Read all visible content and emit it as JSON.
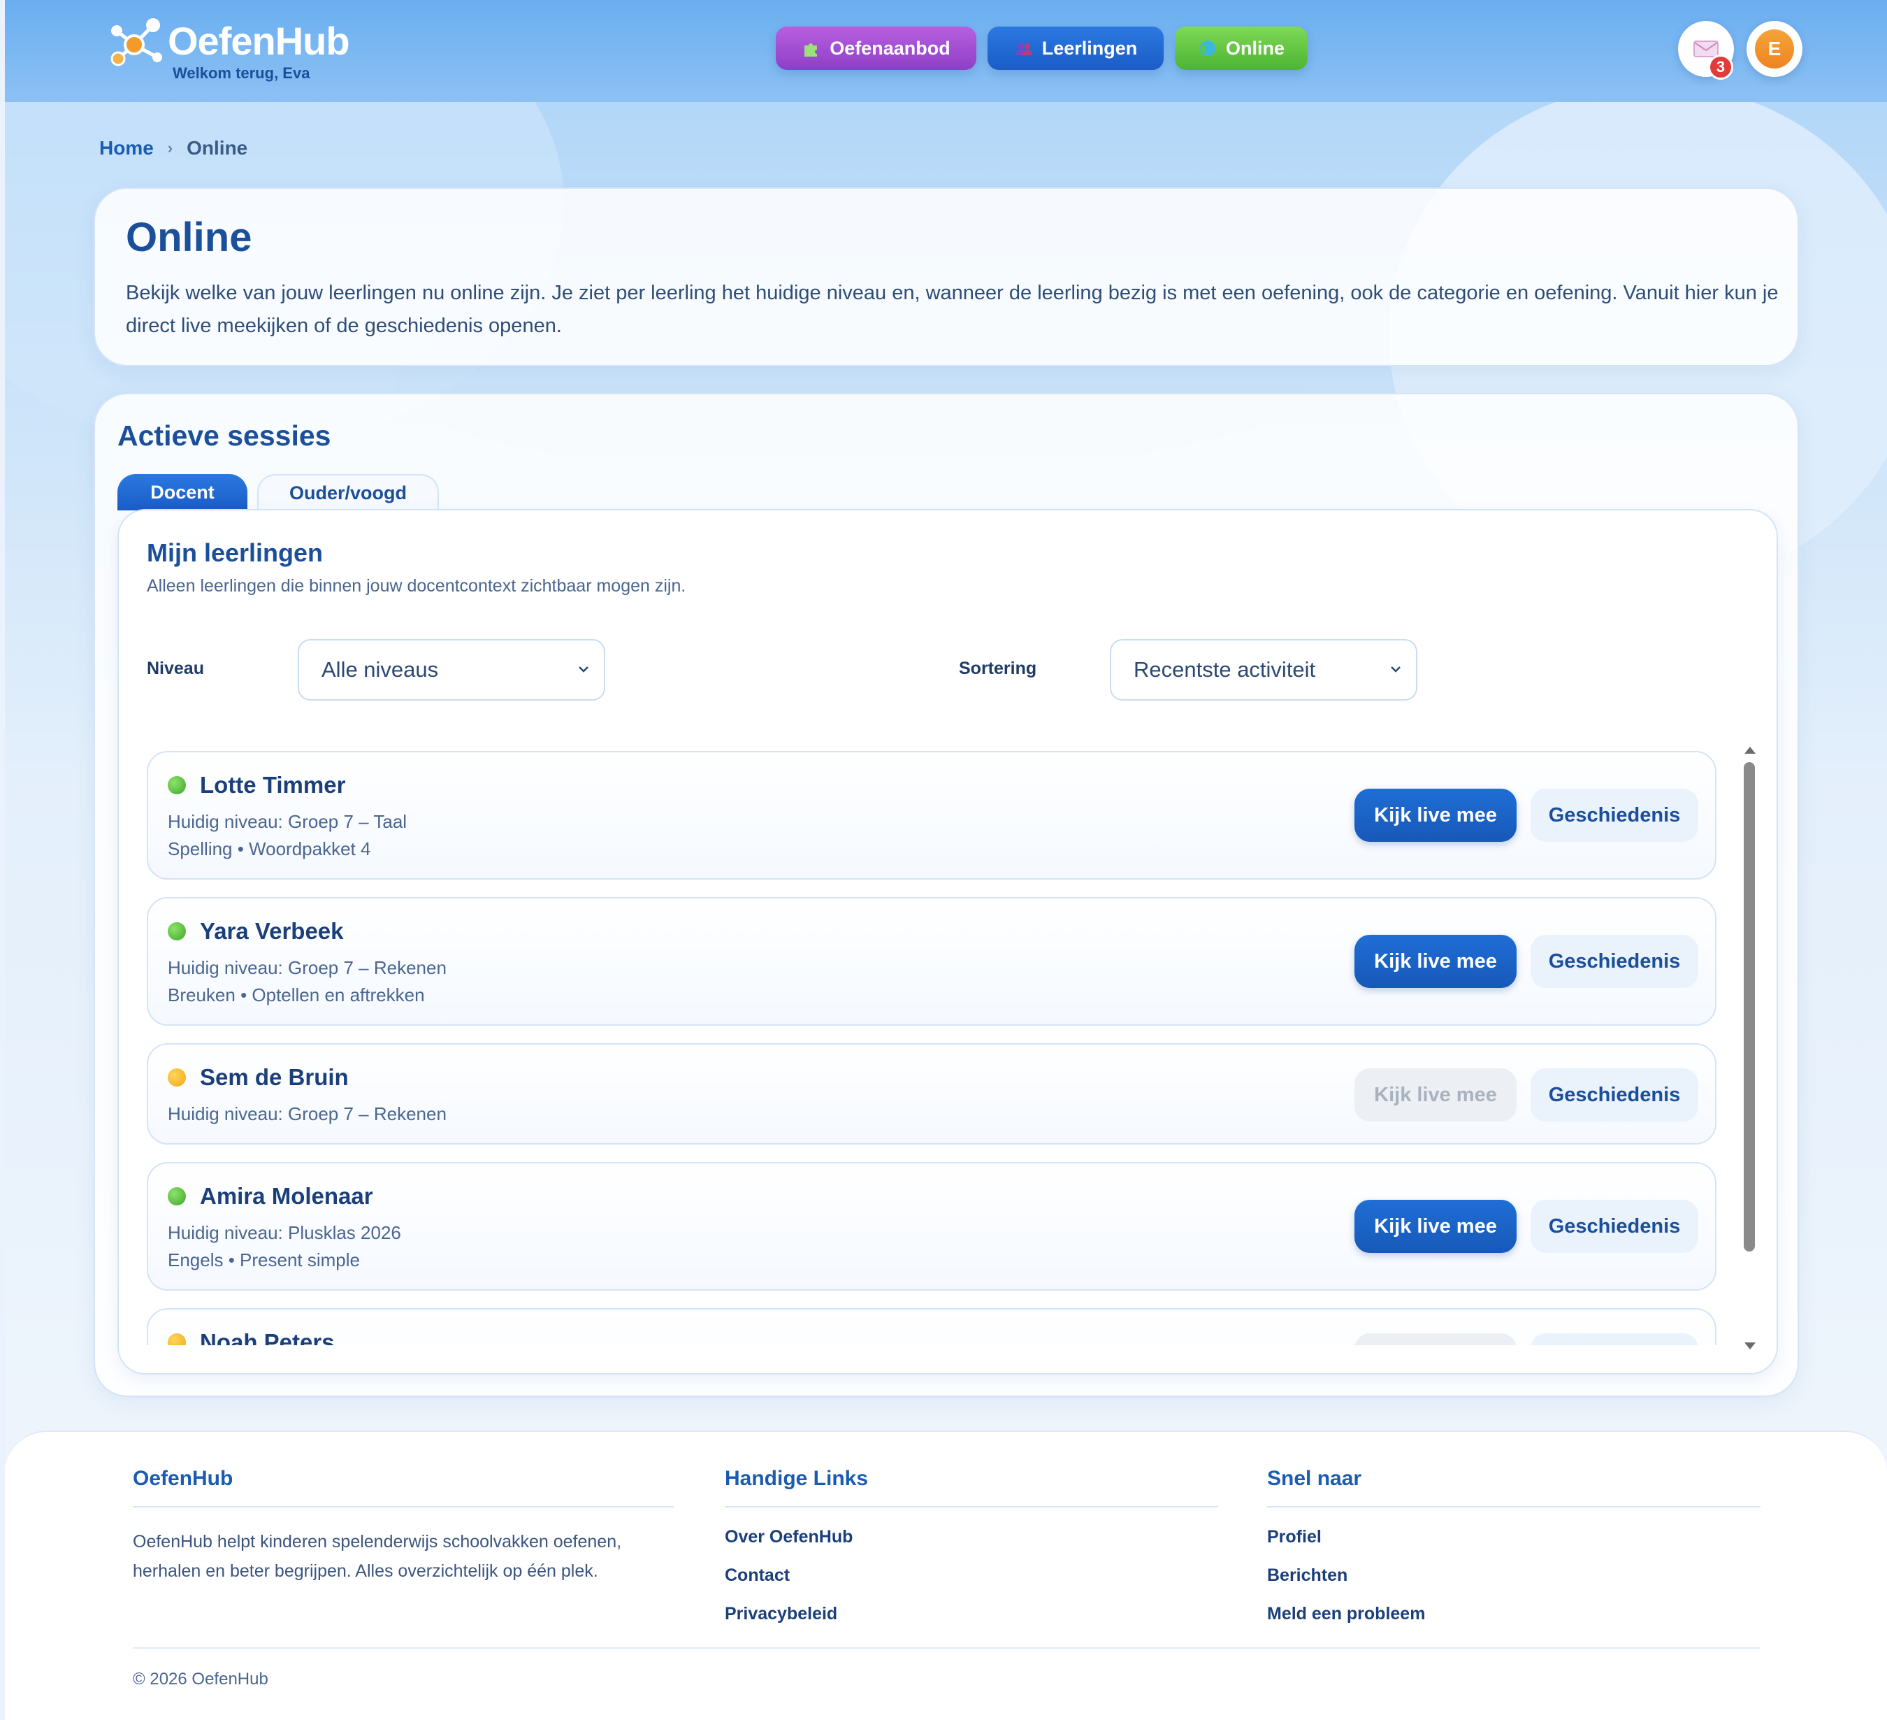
{
  "header": {
    "brand": "OefenHub",
    "welcome": "Welkom terug, Eva",
    "nav": [
      {
        "label": "Oefenaanbod",
        "icon": "puzzle-icon"
      },
      {
        "label": "Leerlingen",
        "icon": "people-icon"
      },
      {
        "label": "Online",
        "icon": "globe-icon"
      }
    ],
    "messages_count": "3",
    "avatar_initial": "E",
    "colors": {
      "purple": "#8e3fc6",
      "blue": "#1b5cc7",
      "green": "#4db532"
    }
  },
  "breadcrumb": {
    "home": "Home",
    "separator": "›",
    "current": "Online"
  },
  "intro": {
    "title": "Online",
    "text": "Bekijk welke van jouw leerlingen nu online zijn. Je ziet per leerling het huidige niveau en, wanneer de leerling bezig is met een oefening, ook de categorie en oefening. Vanuit hier kun je direct live meekijken of de geschiedenis openen."
  },
  "sessions": {
    "title": "Actieve sessies",
    "tabs": [
      {
        "label": "Docent",
        "active": true
      },
      {
        "label": "Ouder/voogd",
        "active": false
      }
    ],
    "panel_title": "Mijn leerlingen",
    "panel_subtitle": "Alleen leerlingen die binnen jouw docentcontext zichtbaar mogen zijn.",
    "filters": {
      "level_label": "Niveau",
      "level_value": "Alle niveaus",
      "sort_label": "Sortering",
      "sort_value": "Recentste activiteit"
    },
    "students": [
      {
        "name": "Lotte Timmer",
        "status": "green",
        "level": "Huidig niveau: Groep 7 – Taal",
        "activity": "Spelling • Woordpakket 4",
        "live_enabled": true
      },
      {
        "name": "Yara Verbeek",
        "status": "green",
        "level": "Huidig niveau: Groep 7 – Rekenen",
        "activity": "Breuken • Optellen en aftrekken",
        "live_enabled": true
      },
      {
        "name": "Sem de Bruin",
        "status": "yellow",
        "level": "Huidig niveau: Groep 7 – Rekenen",
        "activity": "",
        "live_enabled": false
      },
      {
        "name": "Amira Molenaar",
        "status": "green",
        "level": "Huidig niveau: Plusklas 2026",
        "activity": "Engels • Present simple",
        "live_enabled": true
      },
      {
        "name": "Noah Peters",
        "status": "yellow",
        "level": "",
        "activity": "",
        "live_enabled": false
      }
    ],
    "live_label": "Kijk live mee",
    "history_label": "Geschiedenis"
  },
  "footer": {
    "about_title": "OefenHub",
    "about_text": "OefenHub helpt kinderen spelenderwijs schoolvakken oefenen, herhalen en beter begrijpen. Alles overzichtelijk op één plek.",
    "links_title": "Handige Links",
    "links": [
      "Over OefenHub",
      "Contact",
      "Privacybeleid"
    ],
    "quick_title": "Snel naar",
    "quick": [
      "Profiel",
      "Berichten",
      "Meld een probleem"
    ],
    "copyright": "© 2026 OefenHub"
  }
}
